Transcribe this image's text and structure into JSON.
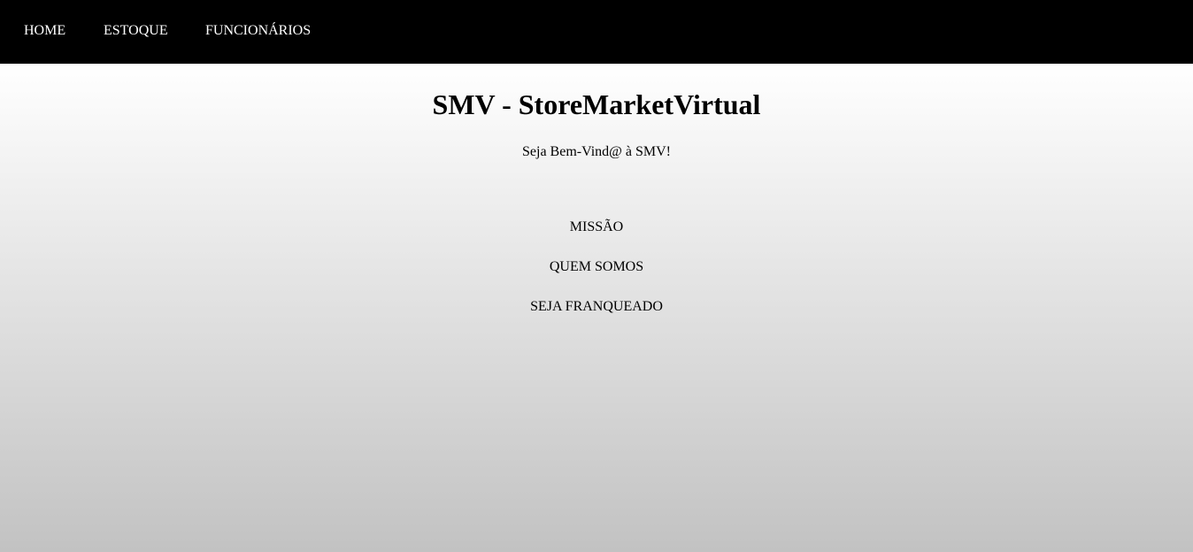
{
  "nav": {
    "items": [
      {
        "label": "HOME"
      },
      {
        "label": "ESTOQUE"
      },
      {
        "label": "FUNCIONÁRIOS"
      }
    ]
  },
  "main": {
    "title": "SMV - StoreMarketVirtual",
    "subtitle": "Seja Bem-Vind@ à SMV!",
    "links": [
      {
        "label": "MISSÃO"
      },
      {
        "label": "QUEM SOMOS"
      },
      {
        "label": "SEJA FRANQUEADO"
      }
    ]
  },
  "colors": {
    "navbar_bg": "#000000",
    "nav_text": "#ffffff",
    "gradient_top": "#ffffff",
    "gradient_bottom": "#c2c2c2"
  }
}
